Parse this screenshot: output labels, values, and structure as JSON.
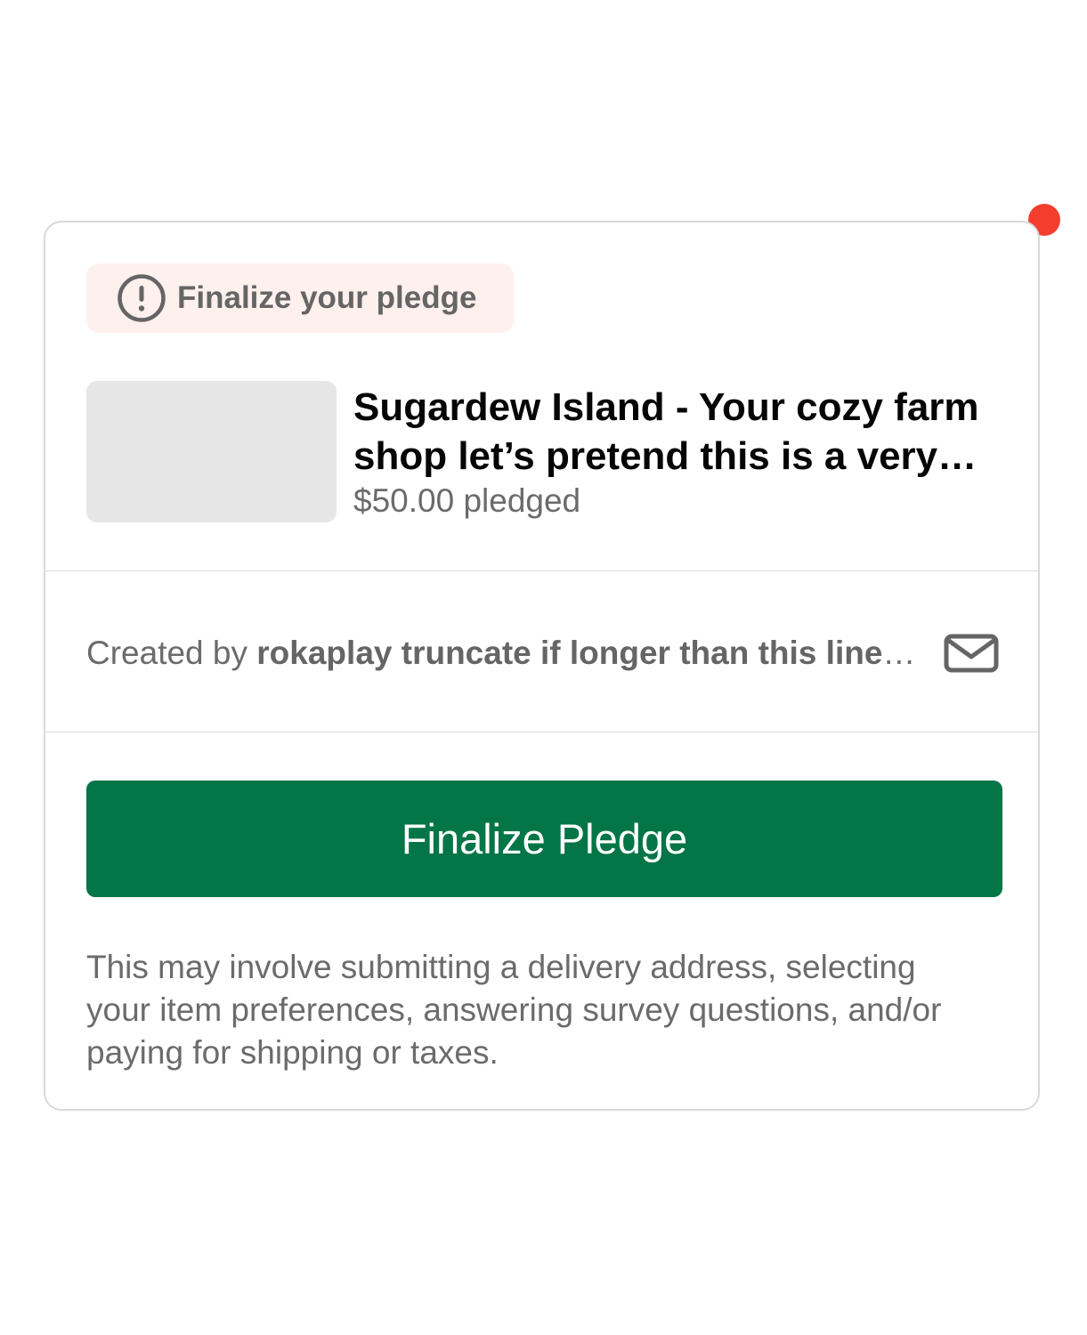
{
  "status_badge": {
    "label": "Finalize your pledge",
    "icon": "exclamation-circle-icon"
  },
  "project": {
    "title": "Sugardew Island - Your cozy farm shop let’s pretend this is a very long project title that gets truncated",
    "pledged": "$50.00 pledged"
  },
  "creator": {
    "prefix": "Created by ",
    "name": "rokaplay truncate if longer than this line allows for display",
    "contact_icon": "envelope-icon"
  },
  "primary_action": {
    "label": "Finalize Pledge"
  },
  "note": "This may involve submitting a delivery address, selecting your item preferences, answering survey questions, and/or paying for shipping or taxes.",
  "colors": {
    "primary": "#037547",
    "badge_background": "#fef0ec",
    "notification_dot": "#f53d2e",
    "muted_text": "#6b6b6b"
  }
}
